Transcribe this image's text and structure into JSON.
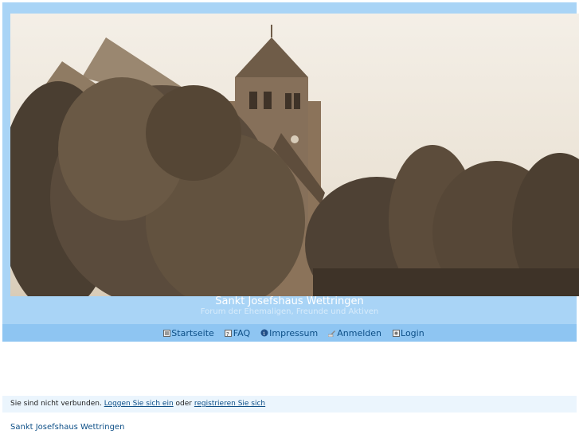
{
  "header": {
    "title": "Sankt Josefshaus Wettringen",
    "subtitle": "Forum der Ehemaligen, Freunde und Aktiven"
  },
  "nav": {
    "items": [
      {
        "label": "Startseite",
        "icon": "home-icon"
      },
      {
        "label": "FAQ",
        "icon": "faq-icon"
      },
      {
        "label": "Impressum",
        "icon": "info-icon"
      },
      {
        "label": "Anmelden",
        "icon": "register-icon"
      },
      {
        "label": "Login",
        "icon": "login-icon"
      }
    ]
  },
  "status": {
    "text": "Sie sind nicht verbunden.",
    "login_link": "Loggen Sie sich ein",
    "or_text": "oder",
    "register_link": "registrieren Sie sich"
  },
  "footer": {
    "link": "Sankt Josefshaus Wettringen"
  },
  "colors": {
    "frame": "#a9d4f6",
    "navbar": "#8ec5f2",
    "link": "#0d4f87",
    "status_bg": "#ebf5fd"
  }
}
